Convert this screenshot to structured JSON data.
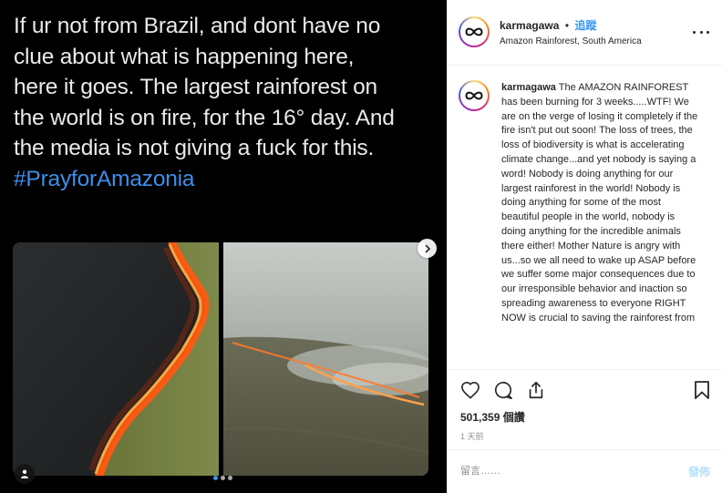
{
  "media": {
    "text_lines": [
      "If ur not from Brazil, and dont have no",
      "clue about what is happening here,",
      "here it goes. The largest rainforest on",
      "the world is on fire, for the 16° day. And",
      "the media is not giving a fuck for this."
    ],
    "hashtag": "#PrayforAmazonia",
    "carousel": {
      "total_slides": 3,
      "active_index": 0
    }
  },
  "header": {
    "username": "karmagawa",
    "separator": "•",
    "follow_label": "追蹤",
    "location": "Amazon Rainforest, South America"
  },
  "caption": {
    "username": "karmagawa",
    "text": "The AMAZON RAINFOREST has been burning for 3 weeks.....WTF! We are on the verge of losing it completely if the fire isn't put out soon! The loss of trees, the loss of biodiversity is what is accelerating climate change...and yet nobody is saying a word! Nobody is doing anything for our largest rainforest in the world! Nobody is doing anything for some of the most beautiful people in the world, nobody is doing anything for the incredible animals there either! Mother Nature is angry with us...so we all need to wake up ASAP before we suffer some major consequences due to our irresponsible behavior and inaction so spreading awareness to everyone RIGHT NOW is crucial to saving the rainforest from"
  },
  "stats": {
    "likes": "501,359 個讚",
    "time_ago": "1 天前"
  },
  "comment": {
    "placeholder": "留言……",
    "post_label": "發佈"
  },
  "colors": {
    "accent": "#3897f0",
    "hashtag": "#3f8ee8",
    "post_disabled": "#b2dffc",
    "divider": "#efefef",
    "muted": "#8e8e8e"
  },
  "icons": [
    "infinity-logo-icon",
    "chevron-right-icon",
    "user-tag-icon",
    "heart-icon",
    "comment-icon",
    "share-icon",
    "bookmark-icon",
    "more-options-icon"
  ]
}
